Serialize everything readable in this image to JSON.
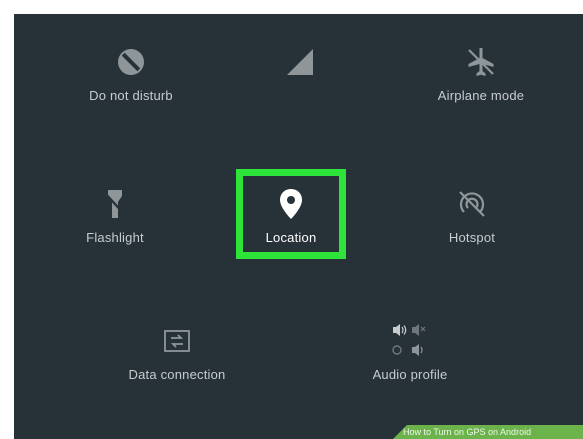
{
  "colors": {
    "panel_background": "#263238",
    "icon_dim": "#8e969a",
    "icon_active": "#ffffff",
    "highlight_border": "#2ee33a",
    "watermark_background": "#6bb34a"
  },
  "quick_settings": {
    "tiles": [
      {
        "label": "Do not disturb",
        "icon": "do-not-disturb-icon",
        "active": false
      },
      {
        "label": "",
        "icon": "signal-icon",
        "active": false
      },
      {
        "label": "Airplane mode",
        "icon": "airplane-icon",
        "active": false
      },
      {
        "label": "Flashlight",
        "icon": "flashlight-icon",
        "active": false
      },
      {
        "label": "Location",
        "icon": "location-pin-icon",
        "active": true
      },
      {
        "label": "Hotspot",
        "icon": "hotspot-icon",
        "active": false
      },
      {
        "label": "Data connection",
        "icon": "data-connection-icon",
        "active": false
      },
      {
        "label": "Audio profile",
        "icon": "audio-profile-icon",
        "active": false
      }
    ]
  },
  "watermark": {
    "text": "How to Turn on GPS on Android"
  }
}
